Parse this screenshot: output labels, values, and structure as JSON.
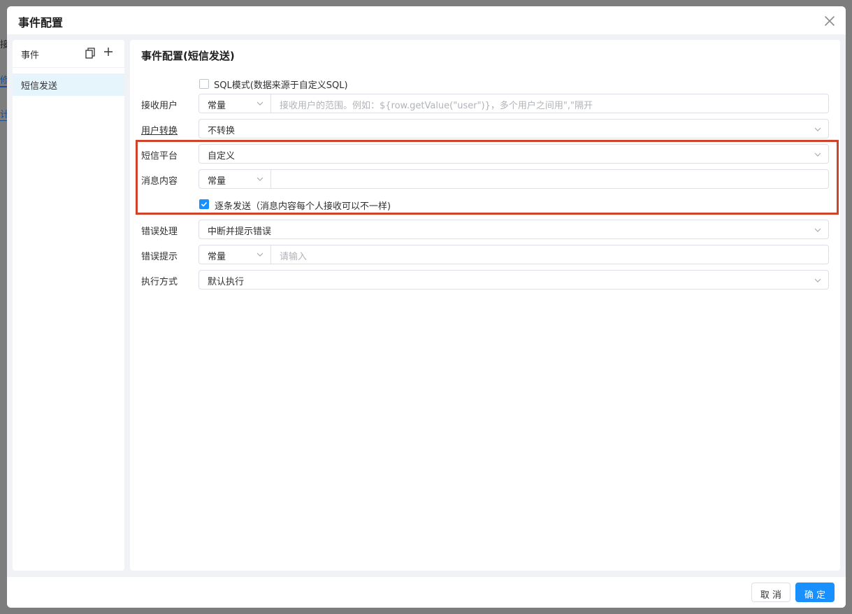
{
  "background": {
    "fragments": [
      "接",
      "修",
      "计"
    ]
  },
  "dialog": {
    "title": "事件配置",
    "footer": {
      "cancel_label": "取 消",
      "ok_label": "确 定"
    }
  },
  "left_panel": {
    "title": "事件",
    "items": [
      {
        "label": "短信发送",
        "selected": true
      }
    ]
  },
  "form": {
    "title": "事件配置(短信发送)",
    "sql_mode": {
      "label": "SQL模式(数据来源于自定义SQL)",
      "checked": false
    },
    "receiver": {
      "label": "接收用户",
      "mode": "常量",
      "placeholder": "接收用户的范围。例如：${row.getValue(\"user\")}，多个用户之间用\",\"隔开",
      "value": ""
    },
    "user_convert": {
      "label": "用户转换",
      "value": "不转换"
    },
    "sms_platform": {
      "label": "短信平台",
      "value": "自定义"
    },
    "message": {
      "label": "消息内容",
      "mode": "常量",
      "value": ""
    },
    "send_individually": {
      "label": "逐条发送（消息内容每个人接收可以不一样)",
      "checked": true
    },
    "error_handling": {
      "label": "错误处理",
      "value": "中断并提示错误"
    },
    "error_tip": {
      "label": "错误提示",
      "mode": "常量",
      "placeholder": "请输入",
      "value": ""
    },
    "exec_mode": {
      "label": "执行方式",
      "value": "默认执行"
    }
  },
  "colors": {
    "primary": "#1890ff",
    "highlight": "#d0432b",
    "selected_bg": "#e6f4fb"
  }
}
